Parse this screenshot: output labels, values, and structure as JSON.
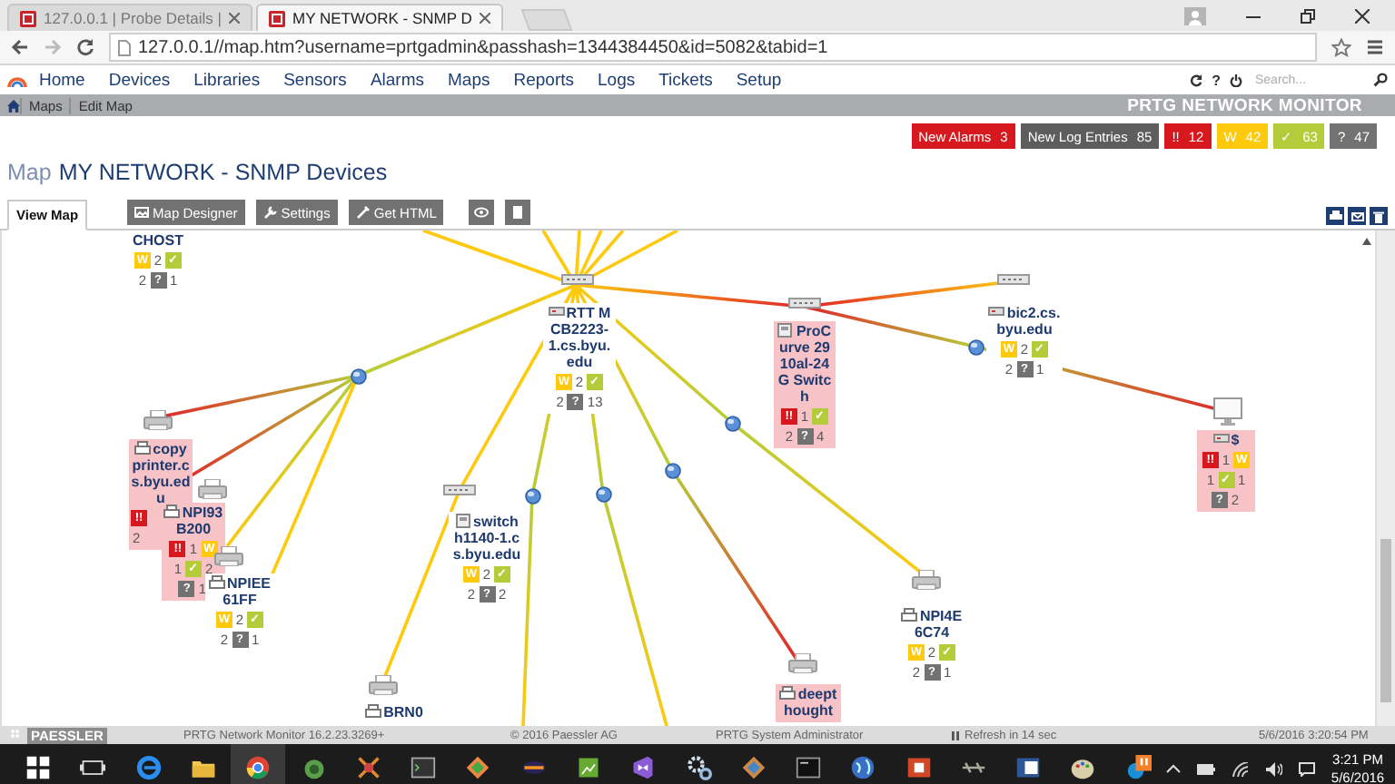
{
  "browser": {
    "tabs": [
      {
        "title": "127.0.0.1 | Probe Details |",
        "selected": false
      },
      {
        "title": "MY NETWORK - SNMP D",
        "selected": true
      }
    ],
    "address": "127.0.0.1//map.htm?username=prtgadmin&passhash=1344384450&id=5082&tabid=1"
  },
  "nav": {
    "items": [
      "Home",
      "Devices",
      "Libraries",
      "Sensors",
      "Alarms",
      "Maps",
      "Reports",
      "Logs",
      "Tickets",
      "Setup"
    ],
    "help": "?",
    "search": {
      "placeholder": "Search..."
    }
  },
  "breadcrumbs": [
    "Maps",
    "Edit Map"
  ],
  "brand": "PRTG NETWORK MONITOR",
  "alerts": [
    {
      "kind": "alarms",
      "label": "New Alarms",
      "count": "3"
    },
    {
      "kind": "log",
      "label": "New Log Entries",
      "count": "85"
    },
    {
      "kind": "down",
      "label": "!!",
      "count": "12"
    },
    {
      "kind": "warning",
      "label": "W",
      "count": "42"
    },
    {
      "kind": "up",
      "label": "✓",
      "count": "63"
    },
    {
      "kind": "unknown",
      "label": "?",
      "count": "47"
    }
  ],
  "page_title": {
    "prefix": "Map",
    "name": "MY NETWORK - SNMP Devices"
  },
  "map_tabs": [
    {
      "label": "View Map",
      "selected": true
    },
    {
      "label": "Map Designer",
      "selected": false
    },
    {
      "label": "Settings",
      "selected": false
    },
    {
      "label": "Get HTML",
      "selected": false
    }
  ],
  "nodes": [
    {
      "name": "CHOST",
      "alert": false,
      "rows": [
        [
          {
            "kind": "warning",
            "text": "W"
          },
          {
            "kind": "count",
            "text": "2"
          },
          {
            "kind": "up",
            "text": "✓"
          }
        ],
        [
          {
            "kind": "count",
            "text": "2"
          },
          {
            "kind": "unknown",
            "text": "?"
          },
          {
            "kind": "count",
            "text": "1"
          }
        ]
      ]
    },
    {
      "name": "RTT MCB2223-1.cs.byu.edu",
      "alert": false,
      "rows": [
        [
          {
            "kind": "warning",
            "text": "W"
          },
          {
            "kind": "count",
            "text": "2"
          },
          {
            "kind": "up",
            "text": "✓"
          }
        ],
        [
          {
            "kind": "count",
            "text": "2"
          },
          {
            "kind": "unknown",
            "text": "?"
          },
          {
            "kind": "count",
            "text": "13"
          }
        ]
      ]
    },
    {
      "name": "ProCurve 2910al-24G Switch",
      "alert": true,
      "rows": [
        [
          {
            "kind": "down",
            "text": "!!"
          },
          {
            "kind": "count",
            "text": "1"
          },
          {
            "kind": "up",
            "text": "✓"
          }
        ],
        [
          {
            "kind": "count",
            "text": "2"
          },
          {
            "kind": "unknown",
            "text": "?"
          },
          {
            "kind": "count",
            "text": "4"
          }
        ]
      ]
    },
    {
      "name": "bic2.cs.byu.edu",
      "alert": false,
      "rows": [
        [
          {
            "kind": "warning",
            "text": "W"
          },
          {
            "kind": "count",
            "text": "2"
          },
          {
            "kind": "up",
            "text": "✓"
          }
        ],
        [
          {
            "kind": "count",
            "text": "2"
          },
          {
            "kind": "unknown",
            "text": "?"
          },
          {
            "kind": "count",
            "text": "1"
          }
        ]
      ]
    },
    {
      "name": "copy printer.cs.byu.edu",
      "alert": true,
      "rows": [
        [
          {
            "kind": "down",
            "text": "!!"
          }
        ],
        [
          {
            "kind": "count",
            "text": "2"
          }
        ]
      ]
    },
    {
      "name": "$",
      "alert": true,
      "rows": [
        [
          {
            "kind": "down",
            "text": "!!"
          },
          {
            "kind": "count",
            "text": "1"
          },
          {
            "kind": "warning",
            "text": "W"
          }
        ],
        [
          {
            "kind": "count",
            "text": "1"
          },
          {
            "kind": "up",
            "text": "✓"
          },
          {
            "kind": "count",
            "text": "1"
          }
        ],
        [
          {
            "kind": "unknown",
            "text": "?"
          },
          {
            "kind": "count",
            "text": "2"
          }
        ]
      ]
    },
    {
      "name": "NPI93B200",
      "alert": true,
      "rows": [
        [
          {
            "kind": "down",
            "text": "!!"
          },
          {
            "kind": "count",
            "text": "1"
          },
          {
            "kind": "warning",
            "text": "W"
          }
        ],
        [
          {
            "kind": "count",
            "text": "1"
          },
          {
            "kind": "up",
            "text": "✓"
          },
          {
            "kind": "count",
            "text": "2"
          }
        ],
        [
          {
            "kind": "unknown",
            "text": "?"
          },
          {
            "kind": "count",
            "text": "1"
          }
        ]
      ]
    },
    {
      "name": "switch h1140-1.cs.byu.edu",
      "alert": false,
      "rows": [
        [
          {
            "kind": "warning",
            "text": "W"
          },
          {
            "kind": "count",
            "text": "2"
          },
          {
            "kind": "up",
            "text": "✓"
          }
        ],
        [
          {
            "kind": "count",
            "text": "2"
          },
          {
            "kind": "unknown",
            "text": "?"
          },
          {
            "kind": "count",
            "text": "2"
          }
        ]
      ]
    },
    {
      "name": "NPIEE61FF",
      "alert": false,
      "rows": [
        [
          {
            "kind": "warning",
            "text": "W"
          },
          {
            "kind": "count",
            "text": "2"
          },
          {
            "kind": "up",
            "text": "✓"
          }
        ],
        [
          {
            "kind": "count",
            "text": "2"
          },
          {
            "kind": "unknown",
            "text": "?"
          },
          {
            "kind": "count",
            "text": "1"
          }
        ]
      ]
    },
    {
      "name": "NPI4E6C74",
      "alert": false,
      "rows": [
        [
          {
            "kind": "warning",
            "text": "W"
          },
          {
            "kind": "count",
            "text": "2"
          },
          {
            "kind": "up",
            "text": "✓"
          }
        ],
        [
          {
            "kind": "count",
            "text": "2"
          },
          {
            "kind": "unknown",
            "text": "?"
          },
          {
            "kind": "count",
            "text": "1"
          }
        ]
      ]
    },
    {
      "name": "BRN0",
      "alert": false
    },
    {
      "name": "deepthought",
      "alert": true
    }
  ],
  "footer": {
    "logo": "PAESSLER",
    "version": "PRTG Network Monitor 16.2.23.3269+",
    "copyright": "© 2016 Paessler AG",
    "user": "PRTG System Administrator",
    "refresh": "Refresh in 14 sec",
    "datetime": "5/6/2016 3:20:54 PM"
  },
  "taskbar": {
    "time": "3:21 PM",
    "date": "5/6/2016"
  }
}
